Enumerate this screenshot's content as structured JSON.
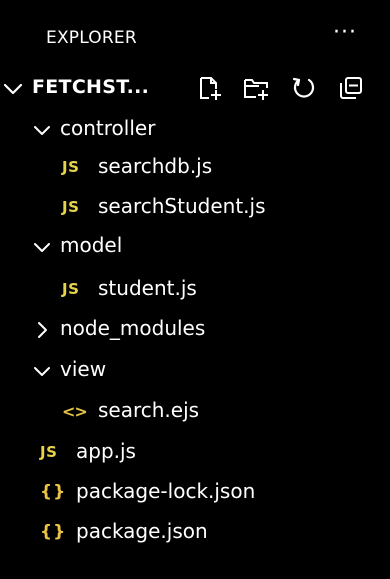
{
  "explorer": {
    "title": "EXPLORER",
    "more_glyph": "···"
  },
  "project": {
    "name": "FETCHST...",
    "actions": [
      "new-file-icon",
      "new-folder-icon",
      "refresh-icon",
      "collapse-all-icon"
    ]
  },
  "tree": {
    "controller": "controller",
    "searchdb": "searchdb.js",
    "searchStudent": "searchStudent.js",
    "model": "model",
    "student": "student.js",
    "node_modules": "node_modules",
    "view": "view",
    "search_ejs": "search.ejs",
    "app": "app.js",
    "package_lock": "package-lock.json",
    "package": "package.json"
  },
  "icons": {
    "js_badge": "JS",
    "ejs_badge": "<>",
    "json_badge": "{}"
  },
  "colors": {
    "background": "#000000",
    "text": "#ffffff",
    "js_yellow": "#e9d34a",
    "json_yellow": "#e8c547"
  }
}
